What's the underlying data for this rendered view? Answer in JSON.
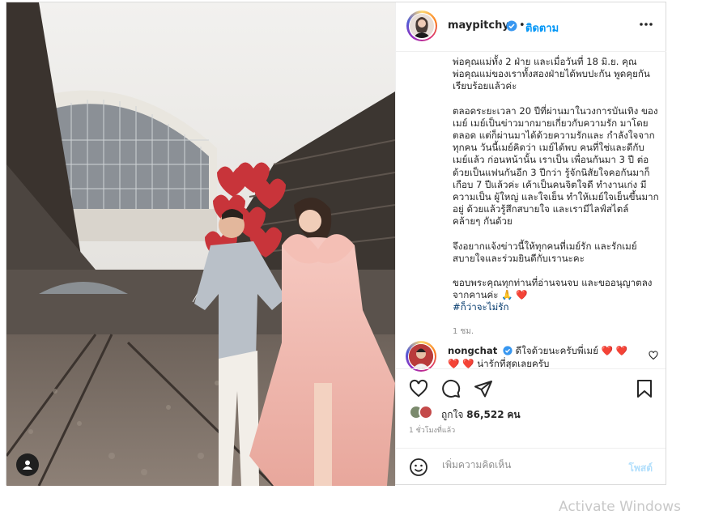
{
  "post": {
    "username": "maypitchy",
    "separator": "•",
    "follow_label": "ติดตาม",
    "caption_paragraphs": [
      "พ่อคุณแม่ทั้ง 2 ฝ่าย และเมื่อวันที่ 18 มิ.ย. คุณพ่อคุณแม่ของเราทั้งสองฝ่ายได้พบปะกัน พูดคุยกันเรียบร้อยแล้วค่ะ",
      "ตลอดระยะเวลา 20 ปีที่ผ่านมาในวงการบันเทิง ของเมย์ เมย์เป็นข่าวมากมายเกี่ยวกับความรัก มาโดยตลอด แต่ก็ผ่านมาได้ด้วยความรักและ กำลังใจจากทุกคน วันนี้เมย์คิดว่า เมย์ได้พบ คนที่ใช่และดีกับเมย์แล้ว ก่อนหน้านั้น เราเป็น เพื่อนกันมา 3 ปี ต่อด้วยเป็นแฟนกันอีก 3 ปีกว่า รู้จักนิสัยใจคอกันมาก็เกือบ 7 ปีแล้วค่ะ เค้าเป็นคนจิตใจดี ทำงานเก่ง มีความเป็น ผู้ใหญ่ และใจเย็น ทำให้เมย์ใจเย็นขึ้นมาก อยู่ ด้วยแล้วรู้สึกสบายใจ และเรามีไลฟ์สไตล์ คล้ายๆ กันด้วย",
      "จึงอยากแจ้งข่าวนี้ให้ทุกคนที่เมย์รัก และรักเมย์ สบายใจและร่วมยินดีกับเรานะคะ"
    ],
    "caption_last_line": "ขอบพระคุณทุกท่านที่อ่านจนจบ และขออนุญาตลงจากคานค่ะ 🙏 ❤️",
    "hashtag": "#ก็ว่าจะไม่รัก",
    "caption_time": "1 ชม.",
    "comment": {
      "username": "nongchat",
      "text": "ดีใจด้วยนะครับพี่เมย์ ❤️ ❤️ ❤️ ❤️ น่ารักที่สุดเลยครับ"
    },
    "likes_label": "ถูกใจ",
    "likes_count": "86,522",
    "likes_unit": "คน",
    "posted_ago": "1 ชั่วโมงที่แล้ว",
    "add_comment_placeholder": "เพิ่มความคิดเห็น",
    "post_button_label": "โพสต์"
  },
  "os_watermark": "Activate Windows",
  "icons": {
    "more": "more-horizontal-icon",
    "verified": "verified-badge-icon",
    "like": "heart-icon",
    "comment": "comment-bubble-icon",
    "share": "paper-plane-icon",
    "save": "bookmark-icon",
    "emoji": "smiley-icon",
    "user_tag": "user-tag-icon"
  },
  "colors": {
    "accent": "#0095f6",
    "verified": "#3897f0",
    "hashtag": "#00376b",
    "muted": "#8e8e8e",
    "post_disabled": "#b2dffc"
  }
}
